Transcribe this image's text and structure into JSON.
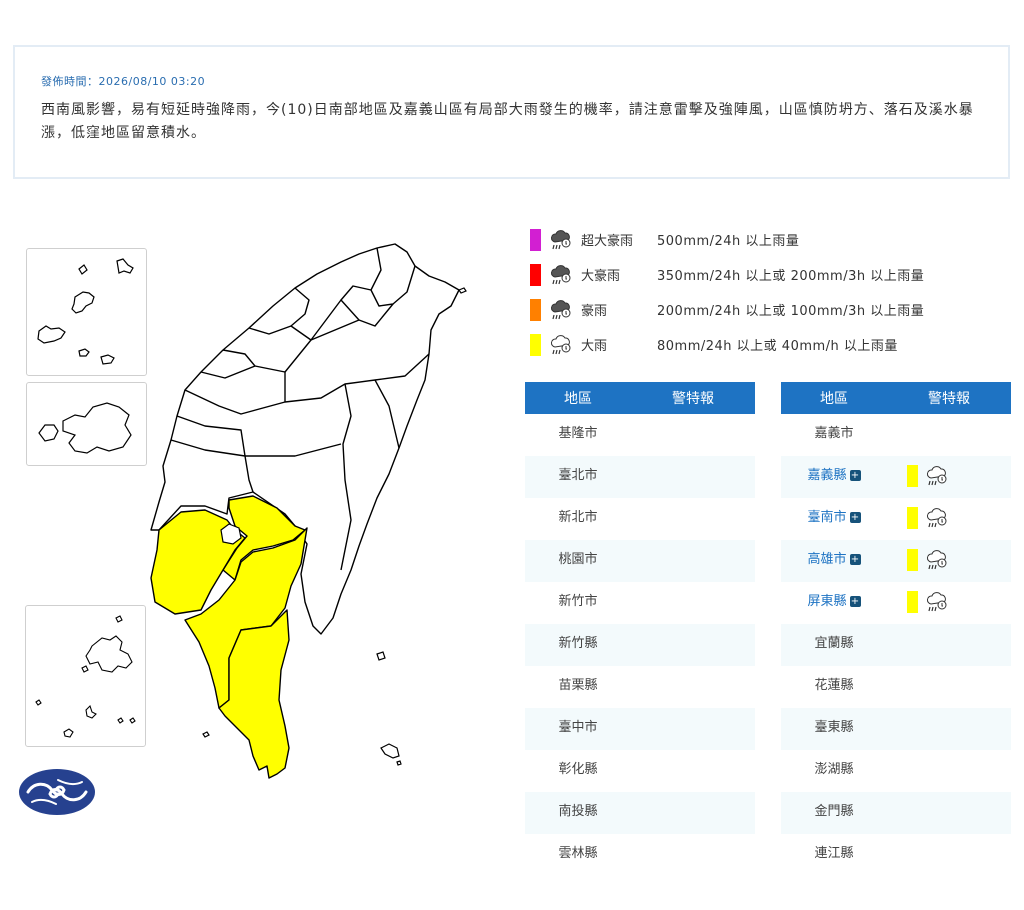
{
  "notice": {
    "time": "發佈時間：2026/08/10 03:20",
    "text": "西南風影響，易有短延時強降雨，今(10)日南部地區及嘉義山區有局部大雨發生的機率，請注意雷擊及強陣風，山區慎防坍方、落石及溪水暴漲，低窪地區留意積水。"
  },
  "legend": [
    {
      "name": "超大豪雨",
      "desc": "500mm/24h 以上雨量",
      "color": "#d21fd2",
      "icon": "thunder-rain-dark-icon"
    },
    {
      "name": "大豪雨",
      "desc": "350mm/24h 以上或 200mm/3h 以上雨量",
      "color": "#ff0000",
      "icon": "thunder-rain-dark-icon"
    },
    {
      "name": "豪雨",
      "desc": "200mm/24h 以上或 100mm/3h 以上雨量",
      "color": "#ff8000",
      "icon": "thunder-rain-dark-icon"
    },
    {
      "name": "大雨",
      "desc": "80mm/24h 以上或 40mm/h 以上雨量",
      "color": "#ffff00",
      "icon": "rain-cloud-outline-icon"
    }
  ],
  "table": {
    "header_region": "地區",
    "header_warning": "警特報",
    "left": [
      {
        "name": "基隆市",
        "warning": false
      },
      {
        "name": "臺北市",
        "warning": false
      },
      {
        "name": "新北市",
        "warning": false
      },
      {
        "name": "桃園市",
        "warning": false
      },
      {
        "name": "新竹市",
        "warning": false
      },
      {
        "name": "新竹縣",
        "warning": false
      },
      {
        "name": "苗栗縣",
        "warning": false
      },
      {
        "name": "臺中市",
        "warning": false
      },
      {
        "name": "彰化縣",
        "warning": false
      },
      {
        "name": "南投縣",
        "warning": false
      },
      {
        "name": "雲林縣",
        "warning": false
      }
    ],
    "right": [
      {
        "name": "嘉義市",
        "warning": false
      },
      {
        "name": "嘉義縣",
        "warning": true
      },
      {
        "name": "臺南市",
        "warning": true
      },
      {
        "name": "高雄市",
        "warning": true
      },
      {
        "name": "屏東縣",
        "warning": true
      },
      {
        "name": "宜蘭縣",
        "warning": false
      },
      {
        "name": "花蓮縣",
        "warning": false
      },
      {
        "name": "臺東縣",
        "warning": false
      },
      {
        "name": "澎湖縣",
        "warning": false
      },
      {
        "name": "金門縣",
        "warning": false
      },
      {
        "name": "連江縣",
        "warning": false
      }
    ]
  },
  "colors": {
    "header_bg": "#1e73c3",
    "warn_yellow": "#ffff00",
    "link_blue": "#1e73c3",
    "row_alt": "#f3fafc",
    "logo_navy": "#26418f"
  },
  "map": {
    "highlighted_regions": [
      "嘉義縣",
      "臺南市",
      "高雄市",
      "屏東縣"
    ],
    "highlight_color": "#ffff00"
  }
}
